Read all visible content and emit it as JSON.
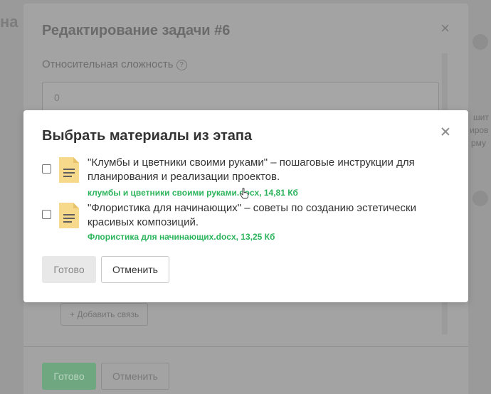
{
  "background": {
    "left_heading": "на",
    "right_fragments": [
      "шит",
      "иров",
      "рму"
    ]
  },
  "edit_dialog": {
    "title": "Редактирование задачи #6",
    "relative_difficulty_label": "Относительная сложность",
    "relative_difficulty_value": "0",
    "add_link_label": "+ Добавить связь",
    "done_label": "Готово",
    "cancel_label": "Отменить"
  },
  "modal": {
    "title": "Выбрать материалы из этапа",
    "items": [
      {
        "description": "\"Клумбы и цветники своими руками\" – пошаговые инструкции для планирования и реализации проектов.",
        "file": "клумбы и цветники своими руками.docx, 14,81 Кб",
        "checked": false
      },
      {
        "description": "\"Флористика для начинающих\" – советы по созданию эстетически красивых композиций.",
        "file": "Флористика для начинающих.docx, 13,25 Кб",
        "checked": false
      }
    ],
    "done_label": "Готово",
    "cancel_label": "Отменить"
  },
  "colors": {
    "accent_green": "#2cb45c",
    "doc_icon": "#f7d98b"
  }
}
